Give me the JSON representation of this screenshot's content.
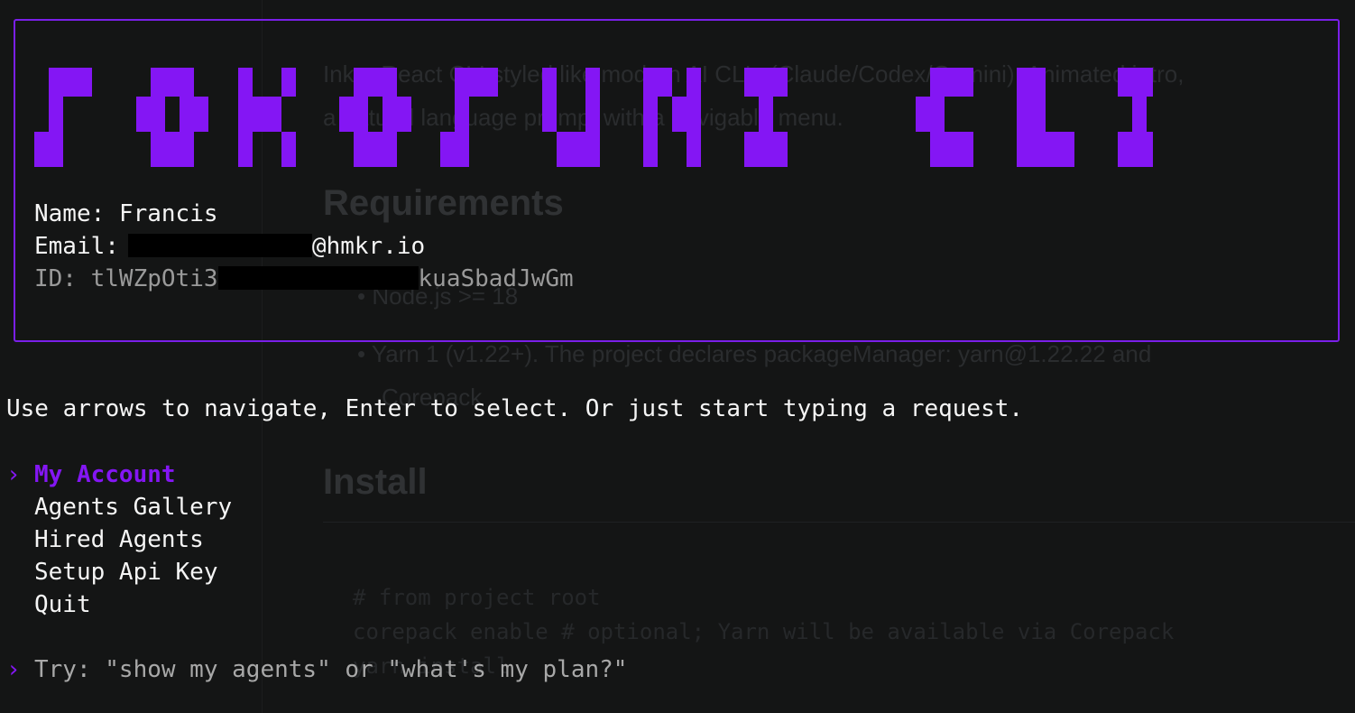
{
  "background_doc": {
    "intro_lines": [
      "Ink + React CLI styled like modern AI CLIs (Claude/Codex/Gemini). Animated intro,",
      "a natural language prompt with a navigable menu."
    ],
    "requirements_heading": "Requirements",
    "requirements": [
      "Node.js >= 18",
      "Yarn 1 (v1.22+). The project declares packageManager: yarn@1.22.22 and",
      "Corepack"
    ],
    "install_heading": "Install",
    "code_lines": [
      "# from project root",
      "corepack enable  # optional; Yarn will be available via Corepack",
      "yarn install"
    ]
  },
  "banner": {
    "accent_color": "#8416f4",
    "user": {
      "name_label": "Name:",
      "name": "Francis",
      "email_label": "Email:",
      "email_visible_suffix": "@hmkr.io",
      "id_label": "ID:",
      "id_visible_prefix": "tlWZpOti3",
      "id_visible_suffix": "kuaSbadJwGm"
    }
  },
  "instructions": "Use arrows to navigate, Enter to select. Or just start typing a request.",
  "menu": {
    "selected_index": 0,
    "caret": "›",
    "items": [
      {
        "label": "My Account"
      },
      {
        "label": "Agents Gallery"
      },
      {
        "label": "Hired Agents"
      },
      {
        "label": "Setup Api Key"
      },
      {
        "label": "Quit"
      }
    ]
  },
  "prompt": {
    "caret": "›",
    "placeholder": "Try: \"show my agents\" or \"what's my plan?\""
  }
}
